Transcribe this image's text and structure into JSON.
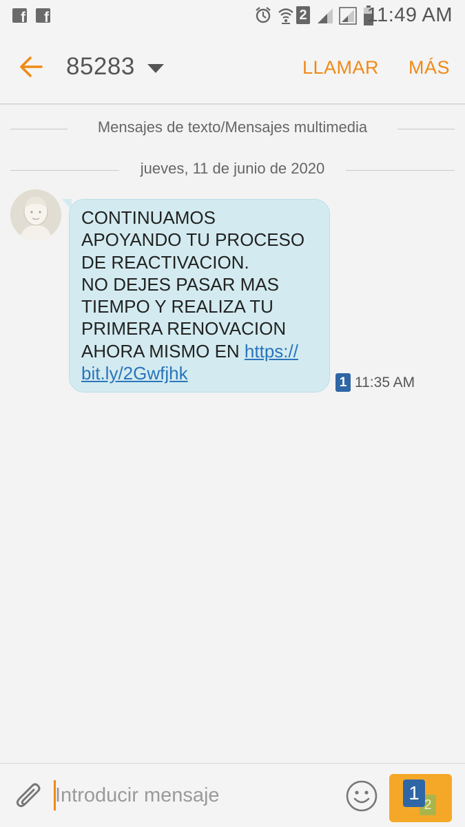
{
  "status_bar": {
    "time": "11:49 AM",
    "sim_number": "2",
    "notification_icons": [
      "facebook-icon",
      "facebook-icon"
    ],
    "system_icons": [
      "alarm-icon",
      "wifi-icon",
      "sim-2-icon",
      "signal-icon",
      "signal-icon",
      "battery-icon"
    ]
  },
  "header": {
    "contact": "85283",
    "call_label": "LLAMAR",
    "more_label": "MÁS",
    "accent_color": "#ef8a15"
  },
  "conversation": {
    "type_label": "Mensajes de texto/Mensajes multimedia",
    "date_label": "jueves, 11 de junio de 2020",
    "messages": [
      {
        "text": "CONTINUAMOS\nAPOYANDO TU PROCESO\nDE REACTIVACION.\nNO DEJES PASAR MAS\nTIEMPO Y REALIZA TU\nPRIMERA RENOVACION\nAHORA MISMO EN ",
        "link": "https://\nbit.ly/2Gwfjhk",
        "sim": "1",
        "time": "11:35 AM"
      }
    ]
  },
  "composer": {
    "placeholder": "Introducir mensaje",
    "value": "",
    "send_sim_primary": "1",
    "send_sim_secondary": "2"
  }
}
